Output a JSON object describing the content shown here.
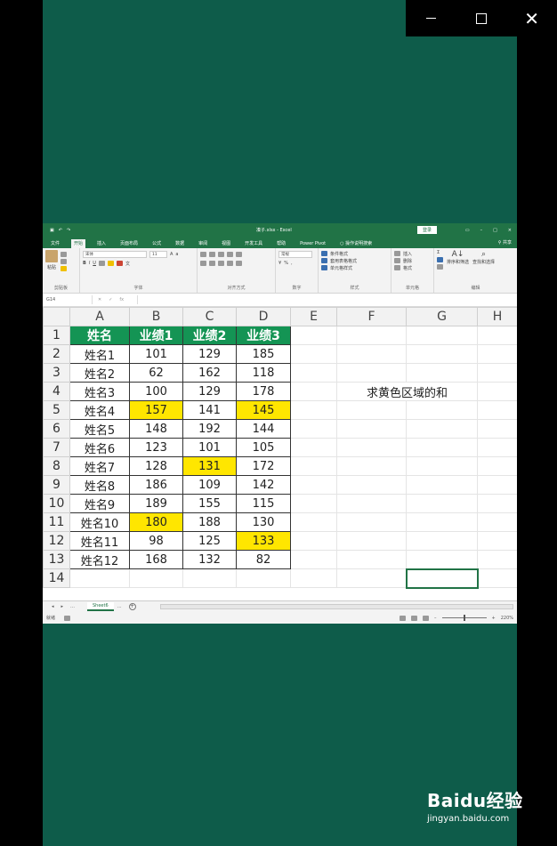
{
  "window_controls": {
    "minimize": "",
    "maximize": "",
    "close": "✕"
  },
  "excel": {
    "title": "凑子.xlsx - Excel",
    "login_label": "登录",
    "menu": [
      "文件",
      "开始",
      "插入",
      "页面布局",
      "公式",
      "数据",
      "审阅",
      "视图",
      "开发工具",
      "帮助",
      "Power Pivot",
      "操作说明搜索"
    ],
    "active_menu": "开始",
    "share_label": "共享",
    "ribbon": {
      "paste": "粘贴",
      "font_name": "宋体",
      "font_size": "11",
      "number_format": "常规",
      "cond_format": "条件格式",
      "table_format": "套用表格格式",
      "cell_style": "单元格样式",
      "insert": "插入",
      "delete": "删除",
      "format": "格式",
      "sort_filter": "排序和筛选",
      "find_select": "查找和选择",
      "groups": [
        "剪贴板",
        "字体",
        "对齐方式",
        "数字",
        "样式",
        "单元格",
        "编辑"
      ]
    },
    "name_box": "G14",
    "column_headers": [
      "A",
      "B",
      "C",
      "D",
      "E",
      "F",
      "G",
      "H"
    ],
    "table_header": [
      "姓名",
      "业绩1",
      "业绩2",
      "业绩3"
    ],
    "rows": [
      {
        "num": "2",
        "name": "姓名1",
        "b": "101",
        "c": "129",
        "d": "185"
      },
      {
        "num": "3",
        "name": "姓名2",
        "b": "62",
        "c": "162",
        "d": "118"
      },
      {
        "num": "4",
        "name": "姓名3",
        "b": "100",
        "c": "129",
        "d": "178"
      },
      {
        "num": "5",
        "name": "姓名4",
        "b": "157",
        "c": "141",
        "d": "145"
      },
      {
        "num": "6",
        "name": "姓名5",
        "b": "148",
        "c": "192",
        "d": "144"
      },
      {
        "num": "7",
        "name": "姓名6",
        "b": "123",
        "c": "101",
        "d": "105"
      },
      {
        "num": "8",
        "name": "姓名7",
        "b": "128",
        "c": "131",
        "d": "172"
      },
      {
        "num": "9",
        "name": "姓名8",
        "b": "186",
        "c": "109",
        "d": "142"
      },
      {
        "num": "10",
        "name": "姓名9",
        "b": "189",
        "c": "155",
        "d": "115"
      },
      {
        "num": "11",
        "name": "姓名10",
        "b": "180",
        "c": "188",
        "d": "130"
      },
      {
        "num": "12",
        "name": "姓名11",
        "b": "98",
        "c": "125",
        "d": "133"
      },
      {
        "num": "13",
        "name": "姓名12",
        "b": "168",
        "c": "132",
        "d": "82"
      }
    ],
    "row1_num": "1",
    "row14_num": "14",
    "note": "求黄色区域的和",
    "highlight_color": "#ffe600",
    "header_color": "#149454",
    "sheet_tab": "Sheet6",
    "status_ready": "就绪",
    "zoom": "220%"
  },
  "watermark": {
    "brand": "Baidu经验",
    "url": "jingyan.baidu.com"
  }
}
